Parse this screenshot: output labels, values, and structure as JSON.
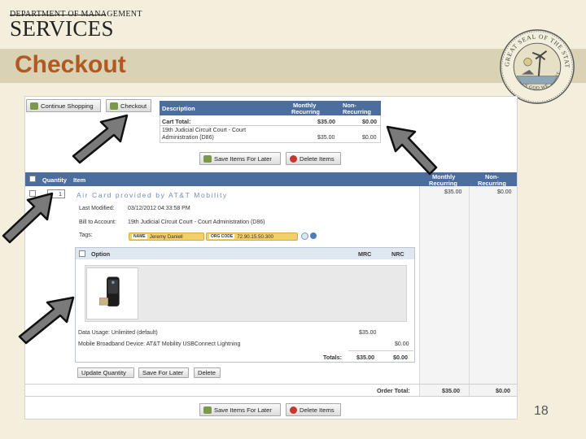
{
  "header": {
    "org_line": "DEPARTMENT OF MANAGEMENT",
    "org_name": "SERVICES",
    "slide_title": "Checkout",
    "seal_text": "GREAT SEAL OF THE STATE OF FLORIDA",
    "seal_motto": "IN GOD WE TRUST"
  },
  "toolbar": {
    "continue_label": "Continue Shopping",
    "checkout_label": "Checkout"
  },
  "summary": {
    "col_description": "Description",
    "col_monthly_1": "Monthly",
    "col_monthly_2": "Recurring",
    "col_non_1": "Non-",
    "col_non_2": "Recurring",
    "cart_total_label": "Cart Total:",
    "cart_total_monthly": "$35.00",
    "cart_total_non": "$0.00",
    "line_desc_1": "19th Judicial Circuit Court - Court",
    "line_desc_2": "Administration (D86)",
    "line_monthly": "$35.00",
    "line_non": "$0.00"
  },
  "actions": {
    "save_later": "Save Items For Later",
    "delete_items": "Delete Items"
  },
  "items_table": {
    "col_quantity": "Quantity",
    "col_item": "Item",
    "col_monthly_1": "Monthly",
    "col_monthly_2": "Recurring",
    "col_non_1": "Non-",
    "col_non_2": "Recurring",
    "quantity": "1",
    "item_name": "Air Card provided by AT&T Mobility",
    "item_monthly": "$35.00",
    "item_non": "$0.00",
    "last_modified_label": "Last Modified:",
    "last_modified_value": "03/12/2012 04:33:58 PM",
    "bill_to_label": "Bill to Account:",
    "bill_to_value": "19th Judicial Circuit Court - Court Administration (D86)",
    "tags_label": "Tags:",
    "tag1_key": "NAME",
    "tag1_value": "Jeremy Daniell",
    "tag2_key": "ORG CODE",
    "tag2_value": "72.90.15.50.300"
  },
  "options": {
    "title": "Option",
    "col_mrc": "MRC",
    "col_nrc": "NRC",
    "row1_label": "Data Usage: Unlimited (default)",
    "row1_mrc": "$35.00",
    "row2_label": "Mobile Broadband Device: AT&T Mobility USBConnect Lightning",
    "row2_nrc": "$0.00",
    "totals_label": "Totals:",
    "totals_mrc": "$35.00",
    "totals_nrc": "$0.00"
  },
  "item_buttons": {
    "update_quantity": "Update Quantity",
    "save_for_later": "Save For Later",
    "delete": "Delete"
  },
  "order": {
    "label": "Order Total:",
    "monthly": "$35.00",
    "non": "$0.00"
  },
  "page_number": "18",
  "colors": {
    "title": "#b05a21",
    "header_blue": "#4c6e9e",
    "arrow_gray": "#7a7a7a",
    "tag_yellow": "#f1cf6a",
    "band": "#d9d2b4"
  }
}
